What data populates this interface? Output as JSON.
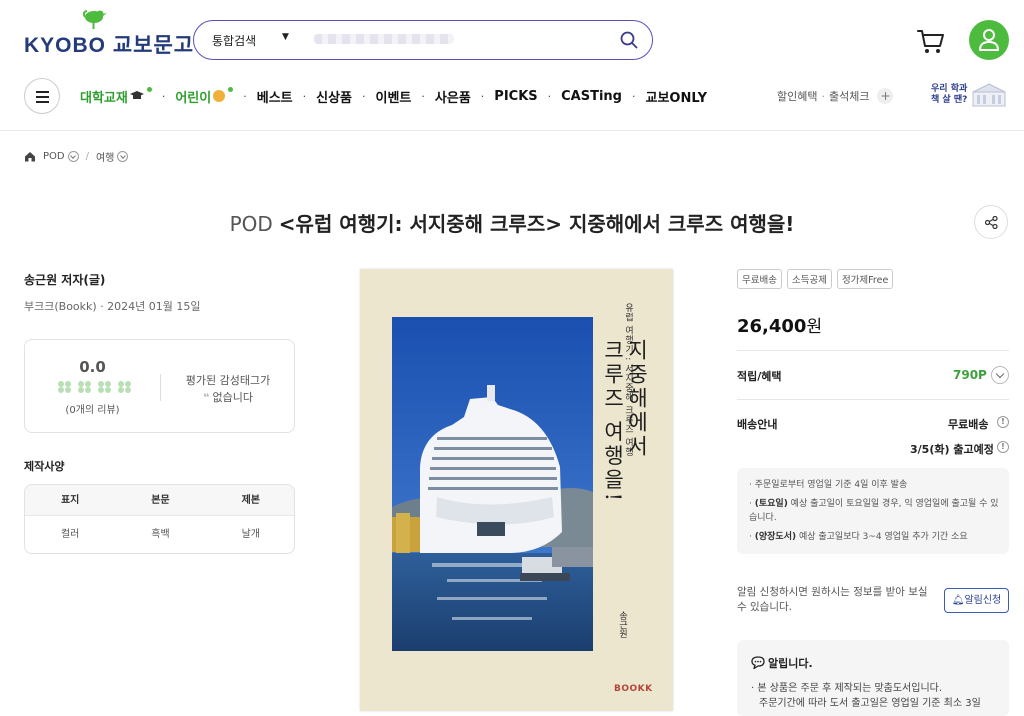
{
  "header": {
    "logo_text": "KYOBO 교보문고",
    "search_scope": "통합검색",
    "search_value": "",
    "nav": [
      {
        "label": "대학교재"
      },
      {
        "label": "어린이"
      },
      {
        "label": "베스트"
      },
      {
        "label": "신상품"
      },
      {
        "label": "이벤트"
      },
      {
        "label": "사은품"
      },
      {
        "label": "PICKS"
      },
      {
        "label": "CASTing"
      },
      {
        "label": "교보ONLY"
      }
    ],
    "util_discount": "할인혜택",
    "util_attendance": "출석체크",
    "campus_line1": "우리 학과",
    "campus_line2": "책 살 땐?"
  },
  "breadcrumb": {
    "items": [
      "POD",
      "여행"
    ],
    "separator": "/"
  },
  "product": {
    "title_tag": "POD",
    "title": "<유럽 여행기: 서지중해 크루즈> 지중해에서 크루즈 여행을!",
    "author": "송근원 저자(글)",
    "publisher_date": "부크크(Bookk) · 2024년 01월 15일",
    "rating": "0.0",
    "review_count": "(0개의 리뷰)",
    "emotion_line1": "평가된 감성태그가",
    "emotion_line2": "없습니다",
    "spec_label": "제작사양",
    "spec_headers": [
      "표지",
      "본문",
      "제본"
    ],
    "spec_values": [
      "컬러",
      "흑백",
      "날개"
    ]
  },
  "cover": {
    "subtitle": "유럽 여행기 : 서지중해 크루즈 여행",
    "title_line1": "지중해에서",
    "title_line2": "크루즈 여행을!",
    "author": "송근원",
    "brand": "BOOKK"
  },
  "purchase": {
    "badges": [
      "무료배송",
      "소득공제",
      "정가제Free"
    ],
    "price": "26,400",
    "price_unit": "원",
    "points_label": "적립/혜택",
    "points_value": "790P",
    "shipping_label": "배송안내",
    "shipping_free": "무료배송",
    "shipping_date": "3/5(화) 출고예정",
    "notices": [
      {
        "bold": "",
        "text": "· 주문일로부터 영업일 기준 4일 이후 발송"
      },
      {
        "bold": "(토요일)",
        "text": " 예상 출고일이 토요일일 경우, 익 영업일에 출고될 수 있습니다."
      },
      {
        "bold": "(양장도서)",
        "text": " 예상 출고일보다 3~4 영업일 추가 기간 소요"
      }
    ],
    "alarm_text": "알림 신청하시면 원하시는 정보를 받아 보실 수 있습니다.",
    "alarm_button": "알림신청",
    "notify_title": "알립니다.",
    "notify_lines": [
      "· 본 상품은 주문 후 제작되는 맞춤도서입니다.",
      "주문기간에 따라 도서 출고일은 영업일 기준 최소 3일"
    ]
  }
}
